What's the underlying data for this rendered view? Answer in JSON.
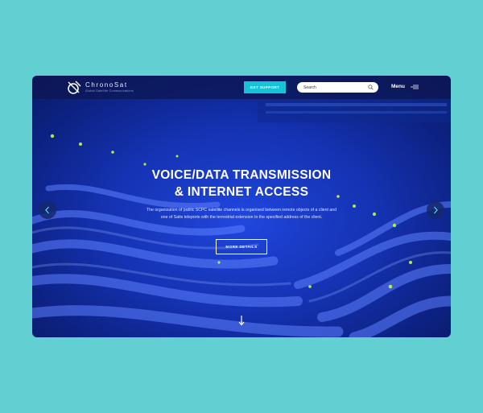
{
  "header": {
    "brand_name": "ChronoSat",
    "brand_tagline": "Global Satellite Communications",
    "support_button": "GET SUPPORT",
    "search_placeholder": "Search",
    "menu_label": "Menu"
  },
  "hero": {
    "title_line1": "VOICE/DATA TRANSMISSION",
    "title_line2": "& INTERNET ACCESS",
    "description": "The organization of public SCPC satellite channels is organised between remote objects of a client and one of Satis teleports with the terrestrial extension to the specified address of the client.",
    "cta_button": "MORE DETAILS"
  },
  "icons": {
    "logo": "satellite-logo-icon",
    "search": "search-icon",
    "menu": "hamburger-menu-icon",
    "prev": "chevron-left-icon",
    "next": "chevron-right-icon",
    "scroll": "arrow-down-icon"
  },
  "colors": {
    "page_background": "#62cfd3",
    "accent": "#17c3d8",
    "hero_blue": "#1432b4",
    "led_green": "#b6e84a"
  }
}
